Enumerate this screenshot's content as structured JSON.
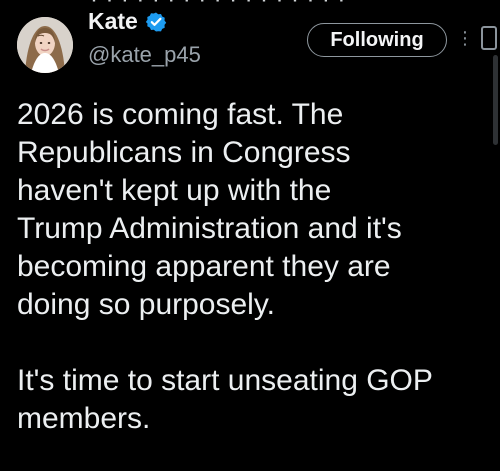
{
  "post": {
    "author": {
      "display_name": "Kate",
      "handle": "@kate_p45",
      "verified": true,
      "avatar_icon": "profile-photo-icon"
    },
    "actions": {
      "follow_label": "Following",
      "more_icon": "more-horizontal-icon",
      "grok_icon": "grok-icon"
    },
    "text_paragraphs": [
      "2026 is coming fast. The\nRepublicans in Congress\nhaven't kept up with the\nTrump Administration and it's\nbecoming apparent they are\ndoing so purposely.",
      "It's time to start unseating GOP\nmembers."
    ]
  },
  "colors": {
    "background": "#000000",
    "text_primary": "#e7e9ea",
    "text_secondary": "#9aa3ab",
    "verified_badge": "#1d9bf0",
    "button_border": "#8e979e"
  }
}
